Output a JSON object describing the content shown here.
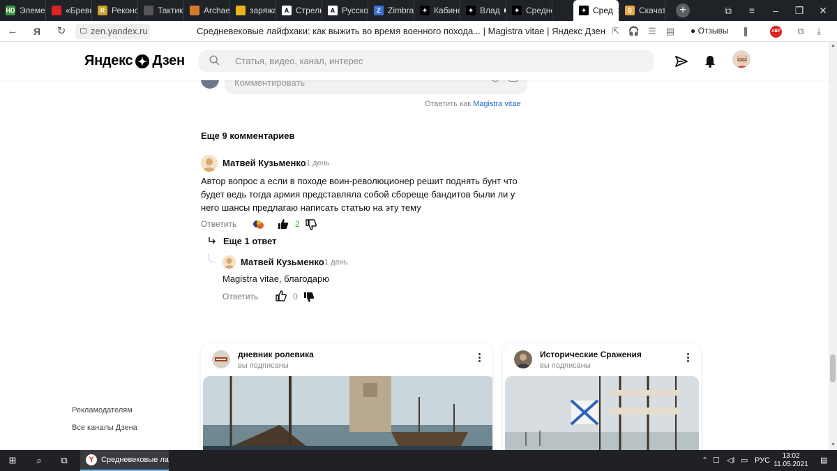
{
  "browser": {
    "tabs": [
      {
        "label": "Элемен",
        "favicon": "hd-icon",
        "fav_text": "HD",
        "fav_color": "#3a9b3a"
      },
      {
        "label": "«Бревн",
        "favicon": "image-icon",
        "fav_text": "",
        "fav_color": "#d9241f"
      },
      {
        "label": "Реконс",
        "favicon": "r-icon",
        "fav_text": "R",
        "fav_color": "#c9a227"
      },
      {
        "label": "Тактика",
        "favicon": "mask-icon",
        "fav_text": "",
        "fav_color": "#555555"
      },
      {
        "label": "Archaeo",
        "favicon": "pick-icon",
        "fav_text": "",
        "fav_color": "#d87a2a"
      },
      {
        "label": "заряжа",
        "favicon": "photo-icon",
        "fav_text": "",
        "fav_color": "#e8b51e"
      },
      {
        "label": "Стрелк",
        "favicon": "a-icon",
        "fav_text": "A",
        "fav_color": "#ffffff"
      },
      {
        "label": "Русское",
        "favicon": "a-icon",
        "fav_text": "A",
        "fav_color": "#ffffff"
      },
      {
        "label": "Zimbra:",
        "favicon": "zimbra-icon",
        "fav_text": "Z",
        "fav_color": "#3b73d1"
      },
      {
        "label": "Кабине",
        "favicon": "dzen-icon",
        "fav_text": "",
        "fav_color": "#000000"
      },
      {
        "label": "Влад",
        "favicon": "dzen-icon",
        "fav_text": "",
        "fav_color": "#000000"
      },
      {
        "label": "Средне",
        "favicon": "dzen-icon",
        "fav_text": "",
        "fav_color": "#000000"
      },
      {
        "label": "Сред",
        "favicon": "dzen-icon",
        "fav_text": "",
        "fav_color": "#000000"
      },
      {
        "label": "Скачать",
        "favicon": "s-icon",
        "fav_text": "S",
        "fav_color": "#e8a94b"
      }
    ],
    "url": "zen.yandex.ru",
    "page_title": "Средневековые лайфхаки: как выжить во время военного похода... | Magistra vitae | Яндекс Дзен",
    "reviews_label": "Отзывы",
    "abp_label": "ABP"
  },
  "header": {
    "logo_left": "Яндекс",
    "logo_right": "Дзен",
    "search_placeholder": "Статья, видео, канал, интерес"
  },
  "comment_input": {
    "placeholder": "Комментировать",
    "answer_as_prefix": "Ответить как",
    "answer_as_name": "Magistra vitae"
  },
  "comments": {
    "more_label": "Еще 9 комментариев",
    "items": [
      {
        "author": "Матвей Кузьменко",
        "time": "1 день",
        "text": "Автор вопрос а если в походе воин-революционер решит поднять бунт что будет ведь тогда армия представляла собой сбореще бандитов были ли у него шансы предлагаю написать статью на эту тему",
        "reply_label": "Ответить",
        "likes": "2",
        "more_replies": "Еще 1 ответ"
      },
      {
        "author": "Матвей Кузьменко",
        "time": "1 день",
        "text": "Magistra vitae, благодарю",
        "reply_label": "Ответить",
        "likes": "0"
      }
    ]
  },
  "cards": [
    {
      "title": "дневник ролевика",
      "subtitle": "вы подписаны"
    },
    {
      "title": "Исторические Сражения",
      "subtitle": "вы подписаны"
    }
  ],
  "footer": {
    "links": [
      "Рекламодателям",
      "Все каналы Дзена"
    ]
  },
  "taskbar": {
    "app_label": "Средневековые ла...",
    "language": "РУС",
    "time": "13:02",
    "date": "11.05.2021"
  }
}
